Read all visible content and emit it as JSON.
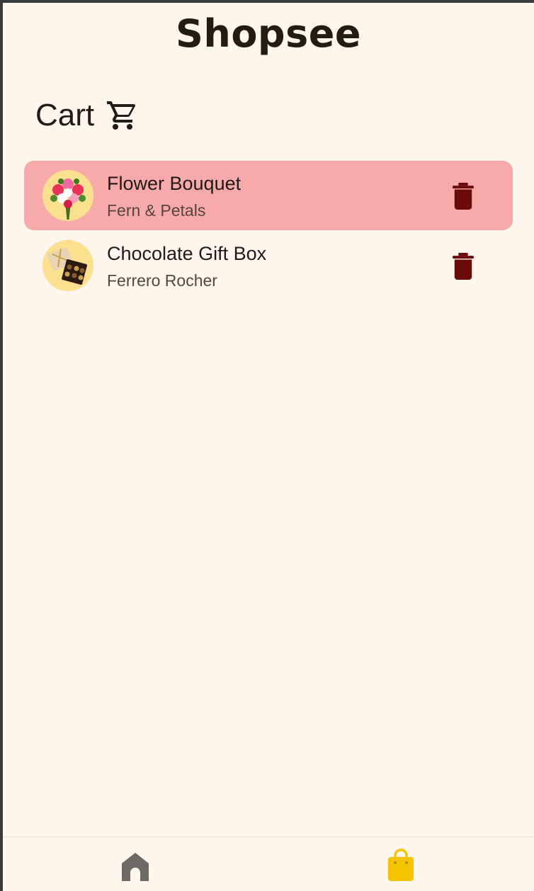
{
  "app": {
    "title": "Shopsee"
  },
  "cart": {
    "heading": "Cart",
    "icon": "shopping-cart-icon",
    "items": [
      {
        "name": "Flower Bouquet",
        "brand": "Fern & Petals",
        "image": "flower-bouquet-image",
        "selected": true
      },
      {
        "name": "Chocolate Gift Box",
        "brand": "Ferrero Rocher",
        "image": "chocolate-box-image",
        "selected": false
      }
    ]
  },
  "nav": {
    "items": [
      {
        "icon": "home-icon",
        "active": false
      },
      {
        "icon": "shopping-bag-icon",
        "active": true
      }
    ]
  },
  "colors": {
    "background": "#fff7ee",
    "selected_row": "#f7aaa9",
    "delete_icon": "#6b0a0a",
    "thumb_bg": "#fbe08f",
    "nav_active": "#f5c400",
    "nav_inactive": "#6d6a66",
    "text_primary": "#1f1b16",
    "text_secondary": "#55473c"
  }
}
